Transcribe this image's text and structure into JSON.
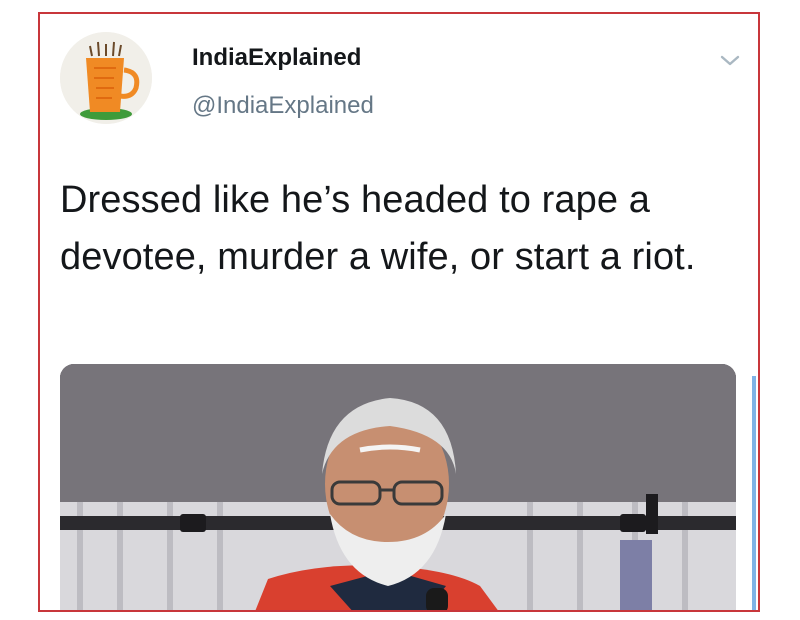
{
  "tweet": {
    "display_name": "IndiaExplained",
    "handle": "@IndiaExplained",
    "text": "Dressed like he’s headed to rape a devotee, murder a wife, or start a riot.",
    "menu_icon": "chevron-down-icon",
    "avatar_icon": "orange-cup-logo-icon",
    "media_description_icon": "photo-image"
  },
  "colors": {
    "frame_border": "#c8363b",
    "name": "#14171a",
    "handle": "#657786",
    "chevron": "#aab8c2",
    "scroll_indicator": "#7fb3e6"
  }
}
